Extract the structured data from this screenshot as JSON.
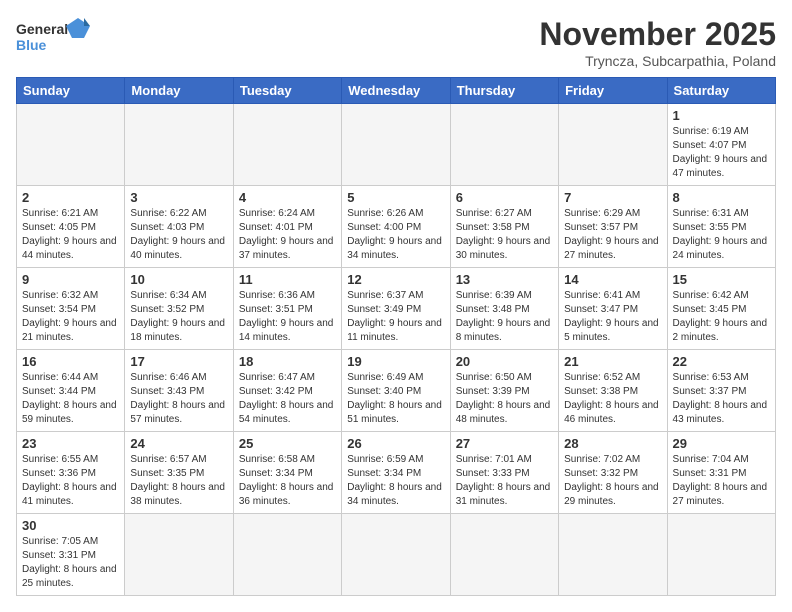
{
  "header": {
    "logo_general": "General",
    "logo_blue": "Blue",
    "title": "November 2025",
    "subtitle": "Tryncza, Subcarpathia, Poland"
  },
  "weekdays": [
    "Sunday",
    "Monday",
    "Tuesday",
    "Wednesday",
    "Thursday",
    "Friday",
    "Saturday"
  ],
  "weeks": [
    [
      {
        "day": "",
        "info": ""
      },
      {
        "day": "",
        "info": ""
      },
      {
        "day": "",
        "info": ""
      },
      {
        "day": "",
        "info": ""
      },
      {
        "day": "",
        "info": ""
      },
      {
        "day": "",
        "info": ""
      },
      {
        "day": "1",
        "info": "Sunrise: 6:19 AM\nSunset: 4:07 PM\nDaylight: 9 hours\nand 47 minutes."
      }
    ],
    [
      {
        "day": "2",
        "info": "Sunrise: 6:21 AM\nSunset: 4:05 PM\nDaylight: 9 hours\nand 44 minutes."
      },
      {
        "day": "3",
        "info": "Sunrise: 6:22 AM\nSunset: 4:03 PM\nDaylight: 9 hours\nand 40 minutes."
      },
      {
        "day": "4",
        "info": "Sunrise: 6:24 AM\nSunset: 4:01 PM\nDaylight: 9 hours\nand 37 minutes."
      },
      {
        "day": "5",
        "info": "Sunrise: 6:26 AM\nSunset: 4:00 PM\nDaylight: 9 hours\nand 34 minutes."
      },
      {
        "day": "6",
        "info": "Sunrise: 6:27 AM\nSunset: 3:58 PM\nDaylight: 9 hours\nand 30 minutes."
      },
      {
        "day": "7",
        "info": "Sunrise: 6:29 AM\nSunset: 3:57 PM\nDaylight: 9 hours\nand 27 minutes."
      },
      {
        "day": "8",
        "info": "Sunrise: 6:31 AM\nSunset: 3:55 PM\nDaylight: 9 hours\nand 24 minutes."
      }
    ],
    [
      {
        "day": "9",
        "info": "Sunrise: 6:32 AM\nSunset: 3:54 PM\nDaylight: 9 hours\nand 21 minutes."
      },
      {
        "day": "10",
        "info": "Sunrise: 6:34 AM\nSunset: 3:52 PM\nDaylight: 9 hours\nand 18 minutes."
      },
      {
        "day": "11",
        "info": "Sunrise: 6:36 AM\nSunset: 3:51 PM\nDaylight: 9 hours\nand 14 minutes."
      },
      {
        "day": "12",
        "info": "Sunrise: 6:37 AM\nSunset: 3:49 PM\nDaylight: 9 hours\nand 11 minutes."
      },
      {
        "day": "13",
        "info": "Sunrise: 6:39 AM\nSunset: 3:48 PM\nDaylight: 9 hours\nand 8 minutes."
      },
      {
        "day": "14",
        "info": "Sunrise: 6:41 AM\nSunset: 3:47 PM\nDaylight: 9 hours\nand 5 minutes."
      },
      {
        "day": "15",
        "info": "Sunrise: 6:42 AM\nSunset: 3:45 PM\nDaylight: 9 hours\nand 2 minutes."
      }
    ],
    [
      {
        "day": "16",
        "info": "Sunrise: 6:44 AM\nSunset: 3:44 PM\nDaylight: 8 hours\nand 59 minutes."
      },
      {
        "day": "17",
        "info": "Sunrise: 6:46 AM\nSunset: 3:43 PM\nDaylight: 8 hours\nand 57 minutes."
      },
      {
        "day": "18",
        "info": "Sunrise: 6:47 AM\nSunset: 3:42 PM\nDaylight: 8 hours\nand 54 minutes."
      },
      {
        "day": "19",
        "info": "Sunrise: 6:49 AM\nSunset: 3:40 PM\nDaylight: 8 hours\nand 51 minutes."
      },
      {
        "day": "20",
        "info": "Sunrise: 6:50 AM\nSunset: 3:39 PM\nDaylight: 8 hours\nand 48 minutes."
      },
      {
        "day": "21",
        "info": "Sunrise: 6:52 AM\nSunset: 3:38 PM\nDaylight: 8 hours\nand 46 minutes."
      },
      {
        "day": "22",
        "info": "Sunrise: 6:53 AM\nSunset: 3:37 PM\nDaylight: 8 hours\nand 43 minutes."
      }
    ],
    [
      {
        "day": "23",
        "info": "Sunrise: 6:55 AM\nSunset: 3:36 PM\nDaylight: 8 hours\nand 41 minutes."
      },
      {
        "day": "24",
        "info": "Sunrise: 6:57 AM\nSunset: 3:35 PM\nDaylight: 8 hours\nand 38 minutes."
      },
      {
        "day": "25",
        "info": "Sunrise: 6:58 AM\nSunset: 3:34 PM\nDaylight: 8 hours\nand 36 minutes."
      },
      {
        "day": "26",
        "info": "Sunrise: 6:59 AM\nSunset: 3:34 PM\nDaylight: 8 hours\nand 34 minutes."
      },
      {
        "day": "27",
        "info": "Sunrise: 7:01 AM\nSunset: 3:33 PM\nDaylight: 8 hours\nand 31 minutes."
      },
      {
        "day": "28",
        "info": "Sunrise: 7:02 AM\nSunset: 3:32 PM\nDaylight: 8 hours\nand 29 minutes."
      },
      {
        "day": "29",
        "info": "Sunrise: 7:04 AM\nSunset: 3:31 PM\nDaylight: 8 hours\nand 27 minutes."
      }
    ],
    [
      {
        "day": "30",
        "info": "Sunrise: 7:05 AM\nSunset: 3:31 PM\nDaylight: 8 hours\nand 25 minutes."
      },
      {
        "day": "",
        "info": ""
      },
      {
        "day": "",
        "info": ""
      },
      {
        "day": "",
        "info": ""
      },
      {
        "day": "",
        "info": ""
      },
      {
        "day": "",
        "info": ""
      },
      {
        "day": "",
        "info": ""
      }
    ]
  ]
}
